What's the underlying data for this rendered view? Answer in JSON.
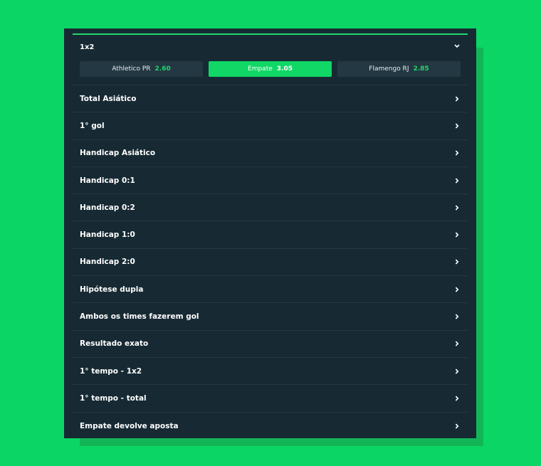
{
  "market_main": {
    "title": "1x2",
    "options": [
      {
        "team": "Athletico PR",
        "odd": "2.60",
        "selected": false
      },
      {
        "team": "Empate",
        "odd": "3.05",
        "selected": true
      },
      {
        "team": "Flamengo RJ",
        "odd": "2.85",
        "selected": false
      }
    ]
  },
  "markets": [
    "Total Asiático",
    "1° gol",
    "Handicap Asiático",
    "Handicap 0:1",
    "Handicap 0:2",
    "Handicap 1:0",
    "Handicap 2:0",
    "Hipótese dupla",
    "Ambos os times fazerem gol",
    "Resultado exato",
    "1° tempo - 1x2",
    "1° tempo - total",
    "Empate devolve aposta"
  ],
  "colors": {
    "background": "#0bd665",
    "panel": "#172a34",
    "accent": "#1fd96a"
  }
}
